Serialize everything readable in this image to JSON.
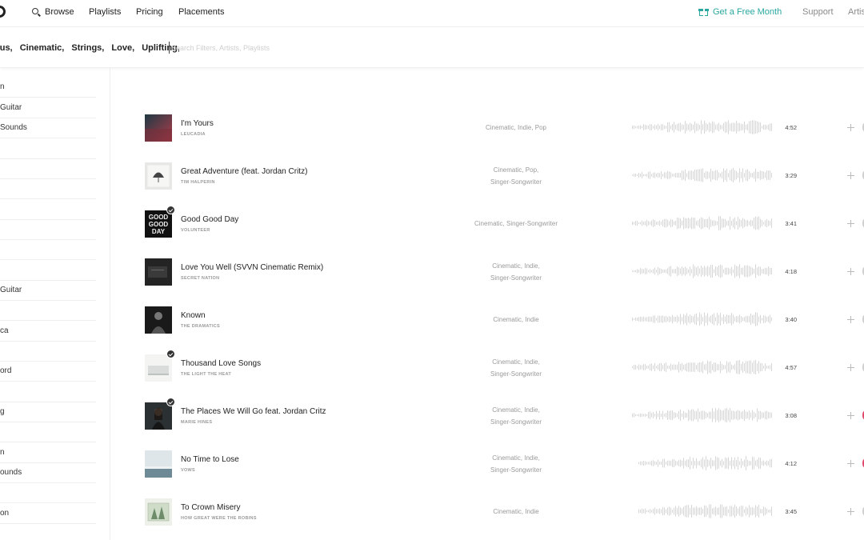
{
  "nav": {
    "browse": "Browse",
    "playlists": "Playlists",
    "pricing": "Pricing",
    "placements": "Placements",
    "free_month": "Get a Free Month",
    "support": "Support",
    "artists": "Artis"
  },
  "filters": {
    "chips": [
      "ous,",
      "Cinematic,",
      "Strings,",
      "Love,",
      "Uplifting,"
    ],
    "search_placeholder": "Search Filters, Artists, Playlists"
  },
  "sidebar": {
    "items": [
      "n",
      "Guitar",
      "Sounds",
      "",
      "",
      "",
      "",
      "",
      "",
      "",
      "Guitar",
      "",
      "ca",
      "",
      "ord",
      "",
      "g",
      "",
      "n",
      "ounds",
      "",
      "on"
    ]
  },
  "tracks": [
    {
      "title": "I'm Yours",
      "artist": "LEUCADIA",
      "genres_line1": "Cinematic,   Indie,   Pop",
      "genres_line2": "",
      "duration": "4:52",
      "checked": false,
      "art": "art-1"
    },
    {
      "title": "Great Adventure (feat. Jordan Critz)",
      "artist": "TIM HALPERIN",
      "genres_line1": "Cinematic,   Pop,",
      "genres_line2": "Singer-Songwriter",
      "duration": "3:29",
      "checked": false,
      "art": "art-2"
    },
    {
      "title": "Good Good Day",
      "artist": "VOLUNTEER",
      "genres_line1": "Cinematic,   Singer-Songwriter",
      "genres_line2": "",
      "duration": "3:41",
      "checked": true,
      "art": "art-3"
    },
    {
      "title": "Love You Well (SVVN Cinematic Remix)",
      "artist": "SECRET NATION",
      "genres_line1": "Cinematic,   Indie,",
      "genres_line2": "Singer-Songwriter",
      "duration": "4:18",
      "checked": false,
      "art": "art-4"
    },
    {
      "title": "Known",
      "artist": "THE DRAMATICS",
      "genres_line1": "Cinematic,   Indie",
      "genres_line2": "",
      "duration": "3:40",
      "checked": false,
      "art": "art-5"
    },
    {
      "title": "Thousand Love Songs",
      "artist": "THE LIGHT THE HEAT",
      "genres_line1": "Cinematic,   Indie,",
      "genres_line2": "Singer-Songwriter",
      "duration": "4:57",
      "checked": true,
      "art": "art-6"
    },
    {
      "title": "The Places We Will Go feat. Jordan Critz",
      "artist": "MARIE HINES",
      "genres_line1": "Cinematic,   Indie,",
      "genres_line2": "Singer-Songwriter",
      "duration": "3:08",
      "checked": true,
      "art": "art-7"
    },
    {
      "title": "No Time to Lose",
      "artist": "VOWS",
      "genres_line1": "Cinematic,   Indie,",
      "genres_line2": "Singer-Songwriter",
      "duration": "4:12",
      "checked": false,
      "art": "art-8"
    },
    {
      "title": "To Crown Misery",
      "artist": "HOW GREAT WERE THE ROBINS",
      "genres_line1": "Cinematic,   Indie",
      "genres_line2": "",
      "duration": "3:45",
      "checked": false,
      "art": "art-9"
    }
  ],
  "colors": {
    "accent": "#2aa7a0",
    "favorite": "#e0486b"
  }
}
